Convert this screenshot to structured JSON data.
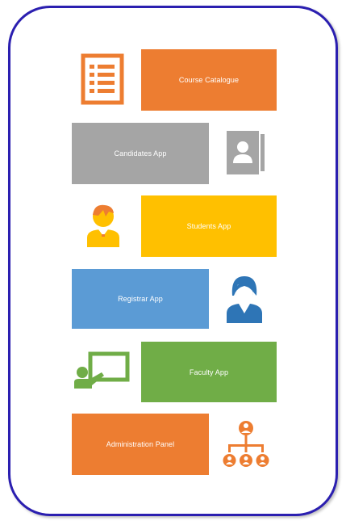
{
  "tiles": {
    "course_catalogue": {
      "label": "Course Catalogue",
      "color": "#ed7d31"
    },
    "candidates_app": {
      "label": "Candidates App",
      "color": "#a5a5a5"
    },
    "students_app": {
      "label": "Students  App",
      "color": "#ffc000"
    },
    "registrar_app": {
      "label": "Registrar App",
      "color": "#5b9bd5"
    },
    "faculty_app": {
      "label": "Faculty App",
      "color": "#70ad47"
    },
    "administration_panel": {
      "label": "Administration Panel",
      "color": "#ed7d31"
    }
  },
  "icons": {
    "course_catalogue": "list-document-icon",
    "candidates_app": "contact-card-icon",
    "students_app": "student-icon",
    "registrar_app": "registrar-woman-icon",
    "faculty_app": "teacher-board-icon",
    "administration_panel": "org-chart-icon"
  },
  "frame": {
    "border_color": "#2b1fb0"
  }
}
